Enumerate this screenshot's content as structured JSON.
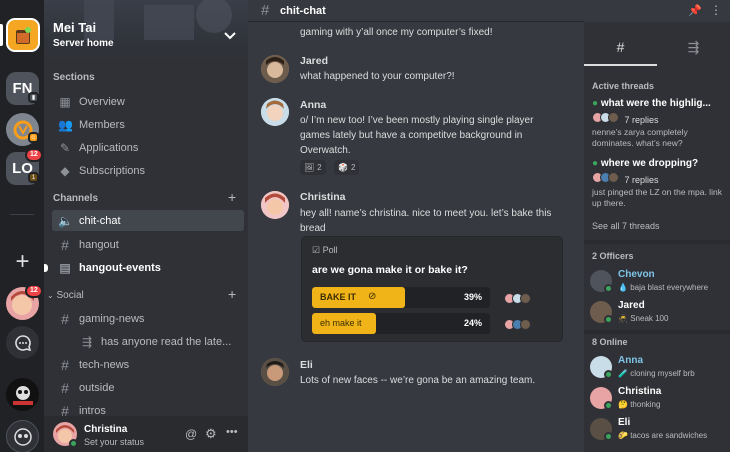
{
  "server": {
    "name": "Mei Tai",
    "subtitle": "Server home",
    "rail": [
      {
        "name": "FN",
        "badge": ""
      },
      {
        "name": "",
        "badge": ""
      },
      {
        "name": "LO",
        "badge": "12"
      },
      {
        "name": "",
        "badge": "12"
      }
    ]
  },
  "sidebar": {
    "sections_title": "Sections",
    "sections": [
      {
        "label": "Overview",
        "icon": "grid-icon"
      },
      {
        "label": "Members",
        "icon": "people-icon"
      },
      {
        "label": "Applications",
        "icon": "edit-icon"
      },
      {
        "label": "Subscriptions",
        "icon": "diamond-icon"
      }
    ],
    "channels_title": "Channels",
    "channels": [
      {
        "label": "chit-chat",
        "icon": "speaker-icon",
        "active": true
      },
      {
        "label": "hangout",
        "icon": "hash-icon"
      },
      {
        "label": "hangout-events",
        "icon": "calendar-icon",
        "bold": true
      }
    ],
    "social_title": "Social",
    "social": [
      {
        "label": "gaming-news",
        "icon": "hash-icon"
      },
      {
        "label": "has anyone read the late...",
        "icon": "thread-icon",
        "thread": true
      },
      {
        "label": "tech-news",
        "icon": "hash-icon"
      },
      {
        "label": "outside",
        "icon": "hash-icon"
      },
      {
        "label": "intros",
        "icon": "hash-icon"
      }
    ]
  },
  "user": {
    "name": "Christina",
    "status": "Set your status"
  },
  "chat": {
    "channel": "chit-chat",
    "top_text": "gaming with y’all once my computer’s fixed!",
    "messages": [
      {
        "author": "Jared",
        "color": "#f0b232",
        "lines": [
          "what happened to your computer?!"
        ]
      },
      {
        "author": "Anna",
        "color": "#80c4e6",
        "lines": [
          "o/ I’m new too! I’ve been mostly playing single player",
          "games lately but have a competitve background in",
          "Overwatch."
        ],
        "reactions": [
          "2",
          "2"
        ]
      },
      {
        "author": "Christina",
        "color": "#ffffff",
        "lines": [
          "hey all! name’s christina. nice to meet you. let’s bake this",
          "bread"
        ]
      },
      {
        "author": "Eli",
        "color": "#8fd17f",
        "lines": [
          "Lots of new faces -- we’re gona be an amazing team."
        ]
      }
    ],
    "poll": {
      "label": "Poll",
      "question": "are we gona make it or bake it?",
      "options": [
        {
          "label": "BAKE IT",
          "percent": "39%",
          "fill": 0.52
        },
        {
          "label": "eh make it",
          "percent": "24%",
          "fill": 0.36
        }
      ]
    }
  },
  "right": {
    "tabs": [
      "#",
      "threads"
    ],
    "active_threads_title": "Active threads",
    "threads": [
      {
        "title": "what were the highlig...",
        "replies": "7 replies",
        "preview": "nenne’s zarya completely dominates. what’s new?"
      },
      {
        "title": "where we dropping?",
        "replies": "7 replies",
        "preview": "just pinged the LZ on the mpa. link up there."
      }
    ],
    "see_all": "See all 7 threads",
    "officers_title": "2 Officers",
    "officers": [
      {
        "name": "Chevon",
        "color": "#80c4e6",
        "status": "baja blast everywhere"
      },
      {
        "name": "Jared",
        "color": "#ffffff",
        "status": "Sneak 100"
      }
    ],
    "online_title": "8 Online",
    "online": [
      {
        "name": "Anna",
        "color": "#80c4e6",
        "status": "cloning myself brb"
      },
      {
        "name": "Christina",
        "color": "#ffffff",
        "status": "thonking"
      },
      {
        "name": "Eli",
        "color": "#ffffff",
        "status": "tacos are sandwiches"
      }
    ]
  }
}
